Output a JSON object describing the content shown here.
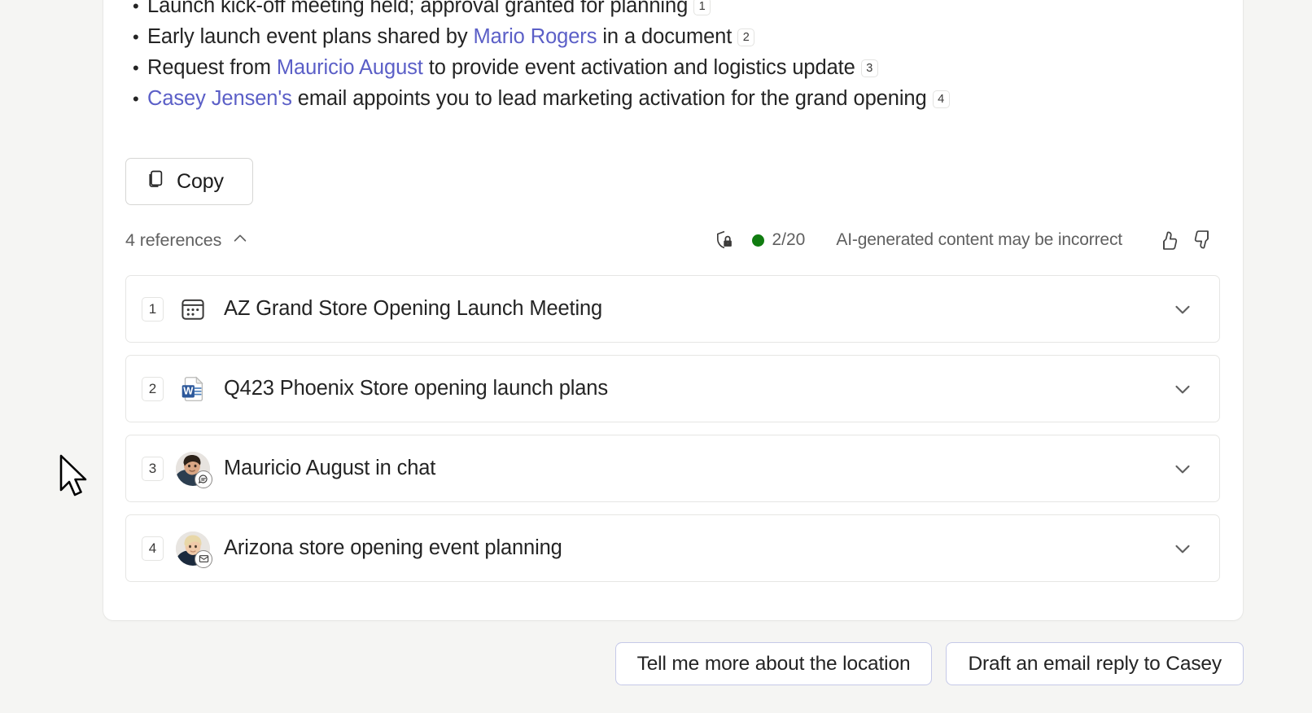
{
  "summary": {
    "bullets": [
      {
        "segments": [
          {
            "text": "Launch kick-off meeting held; approval granted for planning",
            "link": false
          }
        ],
        "citation": "1"
      },
      {
        "segments": [
          {
            "text": "Early launch event plans shared by ",
            "link": false
          },
          {
            "text": "Mario Rogers",
            "link": true
          },
          {
            "text": " in a document",
            "link": false
          }
        ],
        "citation": "2"
      },
      {
        "segments": [
          {
            "text": "Request from ",
            "link": false
          },
          {
            "text": "Mauricio August",
            "link": true
          },
          {
            "text": " to provide event activation and logistics update",
            "link": false
          }
        ],
        "citation": "3"
      },
      {
        "segments": [
          {
            "text": "Casey Jensen's",
            "link": true
          },
          {
            "text": " email appoints you to lead marketing activation for the grand opening",
            "link": false
          }
        ],
        "citation": "4"
      }
    ]
  },
  "actions": {
    "copy_label": "Copy",
    "copy_icon": "copy-icon"
  },
  "references_bar": {
    "count_label": "4 references",
    "collapse_icon": "chevron-up-icon",
    "shield_icon": "shield-lock-icon",
    "quota": "2/20",
    "quota_dot_color": "#107c10",
    "ai_disclaimer": "AI-generated content may be incorrect",
    "thumbs_up_icon": "thumbs-up-icon",
    "thumbs_down_icon": "thumbs-down-icon"
  },
  "references": [
    {
      "number": "1",
      "title": "AZ Grand Store Opening Launch Meeting",
      "icon": "calendar-icon",
      "expand_icon": "chevron-down-icon"
    },
    {
      "number": "2",
      "title": "Q423 Phoenix Store opening launch plans",
      "icon": "word-document-icon",
      "expand_icon": "chevron-down-icon"
    },
    {
      "number": "3",
      "title": "Mauricio August in chat",
      "icon": "avatar-chat-icon",
      "expand_icon": "chevron-down-icon"
    },
    {
      "number": "4",
      "title": "Arizona store opening event planning",
      "icon": "avatar-email-icon",
      "expand_icon": "chevron-down-icon"
    }
  ],
  "suggestions": [
    {
      "label": "Tell me more about the location"
    },
    {
      "label": "Draft an email reply to Casey"
    }
  ],
  "colors": {
    "link": "#5b5fc7",
    "page_background": "#f5f5f3",
    "card_background": "#ffffff",
    "suggestion_border": "#c5c9e8",
    "status_green": "#107c10",
    "word_blue": "#2b579a"
  }
}
